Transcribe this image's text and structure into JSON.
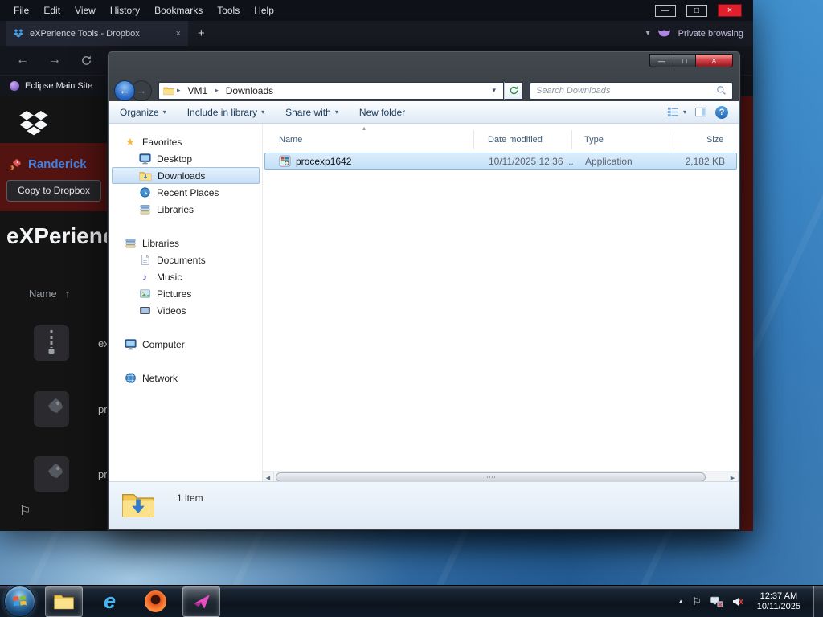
{
  "icons": {
    "chevron_down": "▾",
    "chevron_right": "▸",
    "caret_up": "▴",
    "arrow_up": "↑",
    "back_arrow": "←",
    "forward_arrow": "→",
    "close": "×",
    "minimize": "—",
    "maximize": "□",
    "plus": "+",
    "star": "★",
    "music_note": "♪",
    "flag": "⚐",
    "scroll_left": "◀",
    "scroll_right": "▶",
    "tray_chevron": "▲",
    "help": "?",
    "ie_logo": "e"
  },
  "browser": {
    "menu_items": [
      "File",
      "Edit",
      "View",
      "History",
      "Bookmarks",
      "Tools",
      "Help"
    ],
    "tab_title": "eXPerience Tools - Dropbox",
    "private_label": "Private browsing",
    "bookmark_label": "Eclipse Main Site",
    "page": {
      "brand": "Randerick",
      "copy_button": "Copy to Dropbox",
      "heading": "eXPerience",
      "list_header": "Name",
      "items": [
        {
          "label": "exper"
        },
        {
          "label": "proce"
        },
        {
          "label": "proce"
        }
      ]
    }
  },
  "explorer": {
    "breadcrumb": {
      "root": "VM1",
      "folder": "Downloads"
    },
    "search_placeholder": "Search Downloads",
    "toolbar": {
      "organize": "Organize",
      "include": "Include in library",
      "share": "Share with",
      "new_folder": "New folder"
    },
    "columns": {
      "name": "Name",
      "date": "Date modified",
      "type": "Type",
      "size": "Size"
    },
    "file": {
      "name": "procexp1642",
      "date": "10/11/2025 12:36 ...",
      "type": "Application",
      "size": "2,182 KB"
    },
    "nav": {
      "favorites": "Favorites",
      "favorites_items": [
        "Desktop",
        "Downloads",
        "Recent Places",
        "Libraries"
      ],
      "libraries": "Libraries",
      "libraries_items": [
        "Documents",
        "Music",
        "Pictures",
        "Videos"
      ],
      "computer": "Computer",
      "network": "Network"
    },
    "status_count": "1 item"
  },
  "taskbar": {
    "time": "12:37 AM",
    "date": "10/11/2025"
  },
  "colors": {
    "selection": "#cde8ff",
    "close_button": "#df1f2d",
    "banner_maroon": "#531311",
    "brand_blue": "#3b82e8",
    "private_accent": "#cfc3ea"
  }
}
